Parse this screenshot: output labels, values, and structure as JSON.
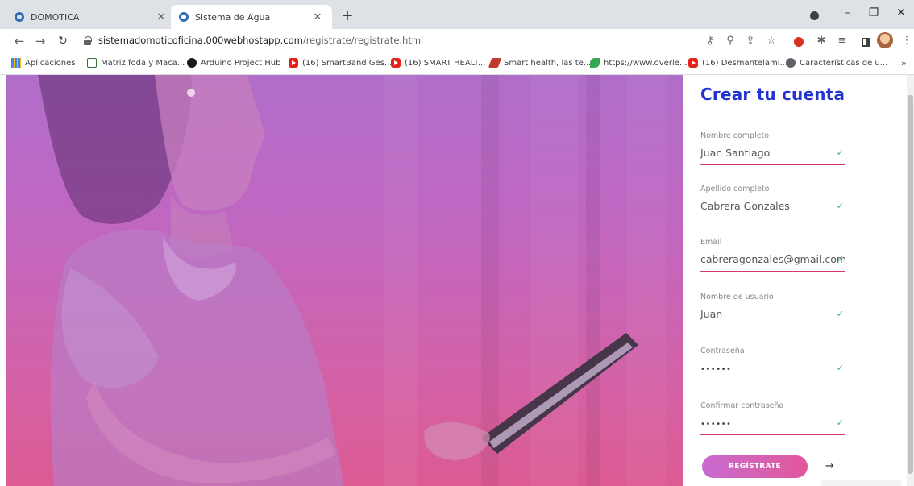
{
  "browser": {
    "tabs": [
      {
        "title": "DOMOTICA",
        "active": false
      },
      {
        "title": "Sistema de Agua",
        "active": true
      }
    ],
    "new_tab": "+",
    "url_host": "sistemadomoticoficina.000webhostapp.com",
    "url_path": "/registrate/registrate.html",
    "bookmarks": [
      {
        "label": "Aplicaciones",
        "icon": "apps-grid-icon"
      },
      {
        "label": "Matriz foda y Maca...",
        "icon": "e-icon"
      },
      {
        "label": "Arduino Project Hub",
        "icon": "arduino-icon"
      },
      {
        "label": "(16) SmartBand Ges...",
        "icon": "youtube-icon"
      },
      {
        "label": "(16) SMART HEALT...",
        "icon": "youtube-icon"
      },
      {
        "label": "Smart health, las te...",
        "icon": "smart-health-icon"
      },
      {
        "label": "https://www.overle...",
        "icon": "overleaf-icon"
      },
      {
        "label": "(16) Desmantelami...",
        "icon": "youtube-icon"
      },
      {
        "label": "Características de u...",
        "icon": "globe-icon"
      }
    ],
    "bookmarks_more": "»"
  },
  "form": {
    "title": "Crear tu cuenta",
    "fields": [
      {
        "label": "Nombre completo",
        "value": "Juan Santiago",
        "valid": true
      },
      {
        "label": "Apellido completo",
        "value": "Cabrera Gonzales",
        "valid": true
      },
      {
        "label": "Email",
        "value": "cabreragonzales@gmail.com",
        "valid": true
      },
      {
        "label": "Nombre de usuario",
        "value": "Juan",
        "valid": true
      },
      {
        "label": "Contraseña",
        "value": "••••••",
        "valid": true
      },
      {
        "label": "Confirmar contraseña",
        "value": "••••••",
        "valid": true
      }
    ],
    "check_mark": "✓",
    "submit_label": "REGÍSTRATE",
    "next_arrow": "→"
  },
  "colors": {
    "title": "#2233d0",
    "underline": "#d43a6e",
    "check": "#3cb371",
    "button_start": "#c86bd0",
    "button_end": "#e2579a"
  }
}
